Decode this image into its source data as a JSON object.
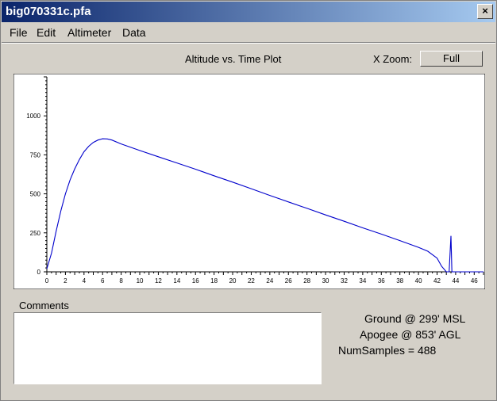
{
  "window": {
    "title": "big070331c.pfa",
    "close_glyph": "×"
  },
  "menu": {
    "items": [
      "File",
      "Edit",
      "Altimeter",
      "Data"
    ]
  },
  "plot": {
    "title": "Altitude vs. Time Plot"
  },
  "zoom": {
    "label": "X Zoom:",
    "button": "Full"
  },
  "comments": {
    "label": "Comments",
    "value": ""
  },
  "info": {
    "ground": "Ground @ 299' MSL",
    "apogee": "Apogee @ 853' AGL",
    "samples": "NumSamples = 488"
  },
  "colors": {
    "series": "#0000cc",
    "titlebar_start": "#0a246a",
    "titlebar_end": "#a6caf0"
  },
  "chart_data": {
    "type": "line",
    "title": "Altitude vs. Time Plot",
    "xlabel": "",
    "ylabel": "",
    "xlim": [
      0,
      47
    ],
    "ylim": [
      0,
      1250
    ],
    "yticks": [
      0,
      250,
      500,
      750,
      1000
    ],
    "xticks": [
      0,
      2,
      4,
      6,
      8,
      10,
      12,
      14,
      16,
      18,
      20,
      22,
      24,
      26,
      28,
      30,
      32,
      34,
      36,
      38,
      40,
      42,
      44,
      46
    ],
    "grid": false,
    "series": [
      {
        "x": [
          0,
          0.5,
          1,
          1.5,
          2,
          2.5,
          3,
          3.5,
          4,
          4.5,
          5,
          5.5,
          6,
          6.5,
          7,
          8,
          10,
          12,
          14,
          16,
          18,
          20,
          22,
          24,
          26,
          28,
          30,
          32,
          34,
          36,
          38,
          40,
          41,
          42,
          42.5,
          43,
          43.3,
          43.5,
          43.6,
          43.7,
          43.8,
          44,
          45,
          46,
          47
        ],
        "y": [
          20,
          120,
          260,
          390,
          500,
          590,
          660,
          720,
          770,
          805,
          830,
          845,
          853,
          852,
          845,
          820,
          778,
          738,
          698,
          658,
          616,
          575,
          533,
          490,
          448,
          407,
          365,
          324,
          282,
          242,
          200,
          157,
          132,
          88,
          35,
          0,
          0,
          230,
          0,
          0,
          0,
          0,
          0,
          0,
          0
        ]
      }
    ]
  }
}
